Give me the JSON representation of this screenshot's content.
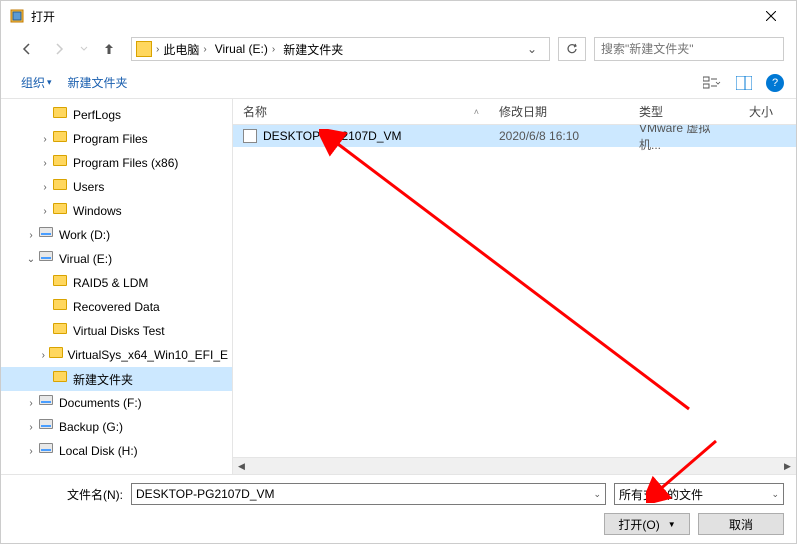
{
  "title": "打开",
  "breadcrumb": [
    {
      "label": "此电脑"
    },
    {
      "label": "Virual (E:)"
    },
    {
      "label": "新建文件夹"
    }
  ],
  "search_placeholder": "搜索\"新建文件夹\"",
  "toolbar": {
    "organize": "组织",
    "new_folder": "新建文件夹"
  },
  "columns": {
    "name": "名称",
    "date": "修改日期",
    "type": "类型",
    "size": "大小"
  },
  "tree": [
    {
      "label": "PerfLogs",
      "indent": 36,
      "icon": "folder",
      "chev": ""
    },
    {
      "label": "Program Files",
      "indent": 36,
      "icon": "folder",
      "chev": "›"
    },
    {
      "label": "Program Files (x86)",
      "indent": 36,
      "icon": "folder",
      "chev": "›"
    },
    {
      "label": "Users",
      "indent": 36,
      "icon": "folder",
      "chev": "›"
    },
    {
      "label": "Windows",
      "indent": 36,
      "icon": "folder",
      "chev": "›"
    },
    {
      "label": "Work (D:)",
      "indent": 22,
      "icon": "drive",
      "chev": "›"
    },
    {
      "label": "Virual (E:)",
      "indent": 22,
      "icon": "drive",
      "chev": "⌄"
    },
    {
      "label": "RAID5 & LDM",
      "indent": 36,
      "icon": "folder",
      "chev": ""
    },
    {
      "label": "Recovered Data",
      "indent": 36,
      "icon": "folder",
      "chev": ""
    },
    {
      "label": "Virtual Disks Test",
      "indent": 36,
      "icon": "folder",
      "chev": ""
    },
    {
      "label": "VirtualSys_x64_Win10_EFI_E",
      "indent": 36,
      "icon": "folder",
      "chev": "›"
    },
    {
      "label": "新建文件夹",
      "indent": 36,
      "icon": "folder",
      "chev": "",
      "selected": true
    },
    {
      "label": "Documents (F:)",
      "indent": 22,
      "icon": "drive",
      "chev": "›"
    },
    {
      "label": "Backup (G:)",
      "indent": 22,
      "icon": "drive",
      "chev": "›"
    },
    {
      "label": "Local Disk (H:)",
      "indent": 22,
      "icon": "drive",
      "chev": "›"
    }
  ],
  "files": [
    {
      "name": "DESKTOP-PG2107D_VM",
      "date": "2020/6/8 16:10",
      "type": "VMware 虚拟机...",
      "selected": true
    }
  ],
  "filename_label": "文件名(N):",
  "filename_value": "DESKTOP-PG2107D_VM",
  "filter_value": "所有支持的文件",
  "open_btn": "打开(O)",
  "cancel_btn": "取消"
}
